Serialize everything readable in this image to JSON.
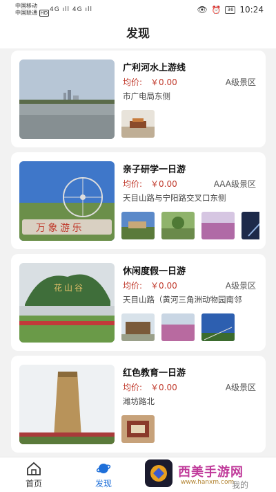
{
  "statusbar": {
    "carrier1": "中国移动",
    "carrier2": "中国联通",
    "hd": "HD",
    "signal": "4G ıll 4G ıll",
    "battery": "36",
    "time": "10:24"
  },
  "header": {
    "title": "发现"
  },
  "cards": [
    {
      "title": "广利河水上游线",
      "price_label": "均价:",
      "price": "￥0.00",
      "level": "A级景区",
      "address": "市广电局东侧"
    },
    {
      "title": "亲子研学一日游",
      "price_label": "均价:",
      "price": "￥0.00",
      "level": "AAA级景区",
      "address": "天目山路与宁阳路交叉口东侧"
    },
    {
      "title": "休闲度假一日游",
      "price_label": "均价:",
      "price": "￥0.00",
      "level": "A级景区",
      "address": "天目山路（黄河三角洲动物园南邻"
    },
    {
      "title": "红色教育一日游",
      "price_label": "均价:",
      "price": "￥0.00",
      "level": "A级景区",
      "address": "潍坊路北"
    }
  ],
  "tabbar": {
    "home": "首页",
    "discover": "发现",
    "mine": "我的"
  },
  "watermark": {
    "text": "西美手游网",
    "url": "www.hanxm.com"
  },
  "colors": {
    "accent": "#1e6fd9",
    "price": "#c0392b"
  }
}
